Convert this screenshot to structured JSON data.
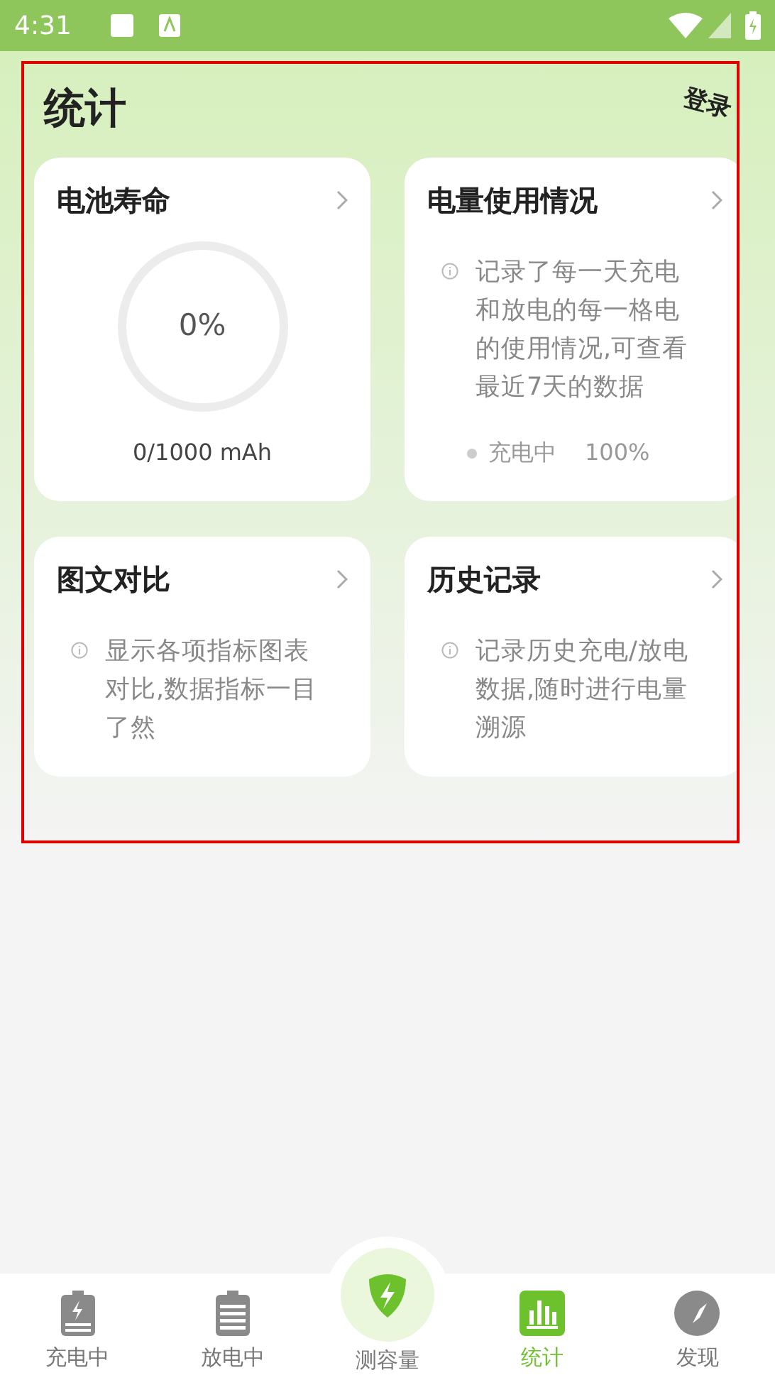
{
  "status_bar": {
    "time": "4:31"
  },
  "header": {
    "title": "统计",
    "login": "登录"
  },
  "cards": [
    {
      "kind": "gauge",
      "title": "电池寿命",
      "reading": "0%",
      "capacity": "0/1000 mAh"
    },
    {
      "kind": "info",
      "title": "电量使用情况",
      "description": "记录了每一天充电和放电的每一格电的使用情况,可查看最近7天的数据",
      "status": "充电中",
      "percent": "100%"
    },
    {
      "kind": "info",
      "title": "图文对比",
      "description": "显示各项指标图表对比,数据指标一目了然"
    },
    {
      "kind": "info",
      "title": "历史记录",
      "description": "记录历史充电/放电数据,随时进行电量溯源"
    }
  ],
  "nav": [
    {
      "kind": "charging",
      "label": "充电中",
      "selected": false
    },
    {
      "kind": "discharging",
      "label": "放电中",
      "selected": false
    },
    {
      "kind": "center",
      "label": "测容量",
      "selected": false
    },
    {
      "kind": "stats",
      "label": "统计",
      "selected": true
    },
    {
      "kind": "discover",
      "label": "发现",
      "selected": false
    }
  ]
}
